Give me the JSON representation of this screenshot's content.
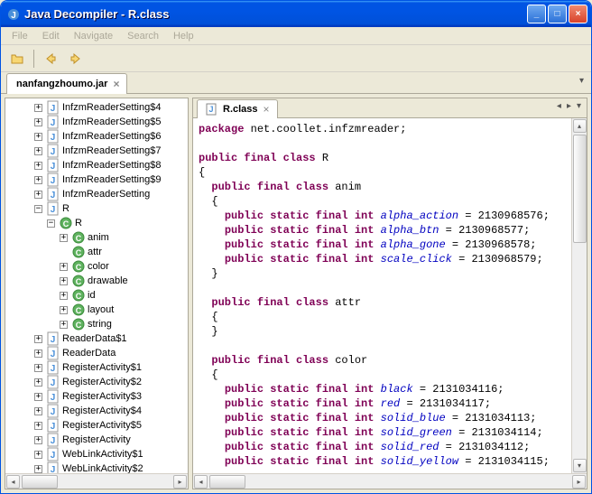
{
  "title": "Java Decompiler - R.class",
  "menus": [
    "File",
    "Edit",
    "Navigate",
    "Search",
    "Help"
  ],
  "jar_tab": "nanfangzhoumo.jar",
  "code_tab": "R.class",
  "tree": [
    {
      "d": 2,
      "t": "plus",
      "i": "j",
      "l": "InfzmReaderSetting$4"
    },
    {
      "d": 2,
      "t": "plus",
      "i": "j",
      "l": "InfzmReaderSetting$5"
    },
    {
      "d": 2,
      "t": "plus",
      "i": "j",
      "l": "InfzmReaderSetting$6"
    },
    {
      "d": 2,
      "t": "plus",
      "i": "j",
      "l": "InfzmReaderSetting$7"
    },
    {
      "d": 2,
      "t": "plus",
      "i": "j",
      "l": "InfzmReaderSetting$8"
    },
    {
      "d": 2,
      "t": "plus",
      "i": "j",
      "l": "InfzmReaderSetting$9"
    },
    {
      "d": 2,
      "t": "plus",
      "i": "j",
      "l": "InfzmReaderSetting"
    },
    {
      "d": 2,
      "t": "minus",
      "i": "j",
      "l": "R"
    },
    {
      "d": 3,
      "t": "minus",
      "i": "c",
      "l": "R"
    },
    {
      "d": 4,
      "t": "plus",
      "i": "c",
      "l": "anim"
    },
    {
      "d": 4,
      "t": "none",
      "i": "c",
      "l": "attr"
    },
    {
      "d": 4,
      "t": "plus",
      "i": "c",
      "l": "color"
    },
    {
      "d": 4,
      "t": "plus",
      "i": "c",
      "l": "drawable"
    },
    {
      "d": 4,
      "t": "plus",
      "i": "c",
      "l": "id"
    },
    {
      "d": 4,
      "t": "plus",
      "i": "c",
      "l": "layout"
    },
    {
      "d": 4,
      "t": "plus",
      "i": "c",
      "l": "string"
    },
    {
      "d": 2,
      "t": "plus",
      "i": "j",
      "l": "ReaderData$1"
    },
    {
      "d": 2,
      "t": "plus",
      "i": "j",
      "l": "ReaderData"
    },
    {
      "d": 2,
      "t": "plus",
      "i": "j",
      "l": "RegisterActivity$1"
    },
    {
      "d": 2,
      "t": "plus",
      "i": "j",
      "l": "RegisterActivity$2"
    },
    {
      "d": 2,
      "t": "plus",
      "i": "j",
      "l": "RegisterActivity$3"
    },
    {
      "d": 2,
      "t": "plus",
      "i": "j",
      "l": "RegisterActivity$4"
    },
    {
      "d": 2,
      "t": "plus",
      "i": "j",
      "l": "RegisterActivity$5"
    },
    {
      "d": 2,
      "t": "plus",
      "i": "j",
      "l": "RegisterActivity"
    },
    {
      "d": 2,
      "t": "plus",
      "i": "j",
      "l": "WebLinkActivity$1"
    },
    {
      "d": 2,
      "t": "plus",
      "i": "j",
      "l": "WebLinkActivity$2"
    }
  ],
  "code": {
    "lines": [
      {
        "tokens": [
          {
            "c": "kw",
            "t": "package"
          },
          {
            "c": "",
            "t": " net.coollet.infzmreader;"
          }
        ]
      },
      {
        "tokens": []
      },
      {
        "tokens": [
          {
            "c": "kw",
            "t": "public final class"
          },
          {
            "c": "",
            "t": " R"
          }
        ]
      },
      {
        "tokens": [
          {
            "c": "",
            "t": "{"
          }
        ]
      },
      {
        "tokens": [
          {
            "c": "",
            "t": "  "
          },
          {
            "c": "kw",
            "t": "public final class"
          },
          {
            "c": "",
            "t": " anim"
          }
        ]
      },
      {
        "tokens": [
          {
            "c": "",
            "t": "  {"
          }
        ]
      },
      {
        "tokens": [
          {
            "c": "",
            "t": "    "
          },
          {
            "c": "kw",
            "t": "public static final int"
          },
          {
            "c": "",
            "t": " "
          },
          {
            "c": "fld",
            "t": "alpha_action"
          },
          {
            "c": "",
            "t": " = 2130968576;"
          }
        ]
      },
      {
        "tokens": [
          {
            "c": "",
            "t": "    "
          },
          {
            "c": "kw",
            "t": "public static final int"
          },
          {
            "c": "",
            "t": " "
          },
          {
            "c": "fld",
            "t": "alpha_btn"
          },
          {
            "c": "",
            "t": " = 2130968577;"
          }
        ]
      },
      {
        "tokens": [
          {
            "c": "",
            "t": "    "
          },
          {
            "c": "kw",
            "t": "public static final int"
          },
          {
            "c": "",
            "t": " "
          },
          {
            "c": "fld",
            "t": "alpha_gone"
          },
          {
            "c": "",
            "t": " = 2130968578;"
          }
        ]
      },
      {
        "tokens": [
          {
            "c": "",
            "t": "    "
          },
          {
            "c": "kw",
            "t": "public static final int"
          },
          {
            "c": "",
            "t": " "
          },
          {
            "c": "fld",
            "t": "scale_click"
          },
          {
            "c": "",
            "t": " = 2130968579;"
          }
        ]
      },
      {
        "tokens": [
          {
            "c": "",
            "t": "  }"
          }
        ]
      },
      {
        "tokens": []
      },
      {
        "tokens": [
          {
            "c": "",
            "t": "  "
          },
          {
            "c": "kw",
            "t": "public final class"
          },
          {
            "c": "",
            "t": " attr"
          }
        ]
      },
      {
        "tokens": [
          {
            "c": "",
            "t": "  {"
          }
        ]
      },
      {
        "tokens": [
          {
            "c": "",
            "t": "  }"
          }
        ]
      },
      {
        "tokens": []
      },
      {
        "tokens": [
          {
            "c": "",
            "t": "  "
          },
          {
            "c": "kw",
            "t": "public final class"
          },
          {
            "c": "",
            "t": " color"
          }
        ]
      },
      {
        "tokens": [
          {
            "c": "",
            "t": "  {"
          }
        ]
      },
      {
        "tokens": [
          {
            "c": "",
            "t": "    "
          },
          {
            "c": "kw",
            "t": "public static final int"
          },
          {
            "c": "",
            "t": " "
          },
          {
            "c": "fld",
            "t": "black"
          },
          {
            "c": "",
            "t": " = 2131034116;"
          }
        ]
      },
      {
        "tokens": [
          {
            "c": "",
            "t": "    "
          },
          {
            "c": "kw",
            "t": "public static final int"
          },
          {
            "c": "",
            "t": " "
          },
          {
            "c": "fld",
            "t": "red"
          },
          {
            "c": "",
            "t": " = 2131034117;"
          }
        ]
      },
      {
        "tokens": [
          {
            "c": "",
            "t": "    "
          },
          {
            "c": "kw",
            "t": "public static final int"
          },
          {
            "c": "",
            "t": " "
          },
          {
            "c": "fld",
            "t": "solid_blue"
          },
          {
            "c": "",
            "t": " = 2131034113;"
          }
        ]
      },
      {
        "tokens": [
          {
            "c": "",
            "t": "    "
          },
          {
            "c": "kw",
            "t": "public static final int"
          },
          {
            "c": "",
            "t": " "
          },
          {
            "c": "fld",
            "t": "solid_green"
          },
          {
            "c": "",
            "t": " = 2131034114;"
          }
        ]
      },
      {
        "tokens": [
          {
            "c": "",
            "t": "    "
          },
          {
            "c": "kw",
            "t": "public static final int"
          },
          {
            "c": "",
            "t": " "
          },
          {
            "c": "fld",
            "t": "solid_red"
          },
          {
            "c": "",
            "t": " = 2131034112;"
          }
        ]
      },
      {
        "tokens": [
          {
            "c": "",
            "t": "    "
          },
          {
            "c": "kw",
            "t": "public static final int"
          },
          {
            "c": "",
            "t": " "
          },
          {
            "c": "fld",
            "t": "solid_yellow"
          },
          {
            "c": "",
            "t": " = 2131034115;"
          }
        ]
      }
    ]
  }
}
